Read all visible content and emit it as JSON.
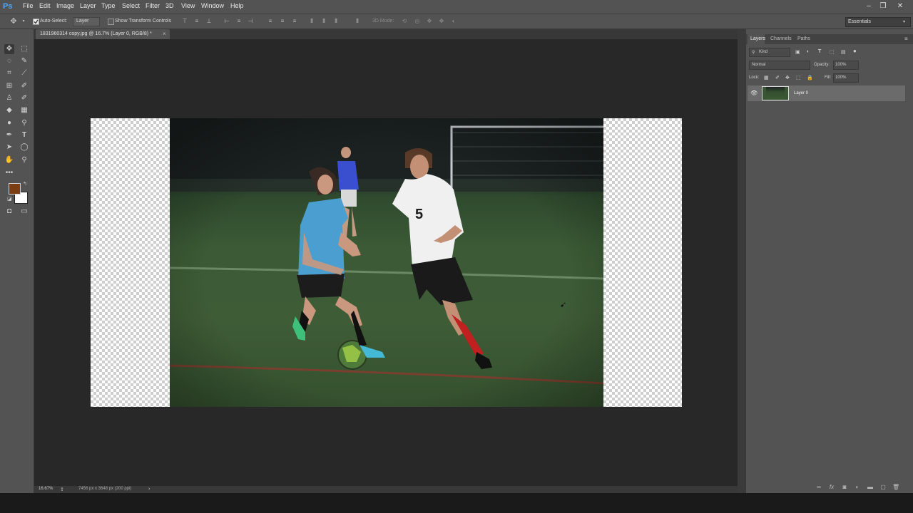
{
  "app": {
    "logo": "Ps"
  },
  "menu": [
    "File",
    "Edit",
    "Image",
    "Layer",
    "Type",
    "Select",
    "Filter",
    "3D",
    "View",
    "Window",
    "Help"
  ],
  "window_controls": {
    "minimize": "–",
    "restore": "❐",
    "close": "✕"
  },
  "options_bar": {
    "auto_select_label": "Auto-Select:",
    "auto_select_checked": true,
    "auto_select_target": "Layer",
    "transform_controls_label": "Show Transform Controls",
    "transform_controls_checked": false,
    "mode_3d_label": "3D Mode:"
  },
  "workspace": {
    "label": "Essentials"
  },
  "document": {
    "tab_title": "1831960314 copy.jpg @ 16.7% (Layer 0, RGB/8) *",
    "close": "×"
  },
  "status": {
    "zoom": "16.67%",
    "doc_info": "7456 px x 3648 px (200 ppi)"
  },
  "colors": {
    "foreground": "#7a3e12",
    "background": "#ffffff",
    "accent": "#4fa8ff"
  },
  "panels": {
    "tabs": [
      "Layers",
      "Channels",
      "Paths"
    ],
    "filter_kind": "Kind",
    "blend_mode": "Normal",
    "opacity_label": "Opacity:",
    "opacity_value": "100%",
    "lock_label": "Lock:",
    "fill_label": "Fill:",
    "fill_value": "100%",
    "layers": [
      {
        "name": "Layer 0",
        "visible": true,
        "selected": true
      }
    ]
  },
  "photo": {
    "player_number": "5"
  }
}
